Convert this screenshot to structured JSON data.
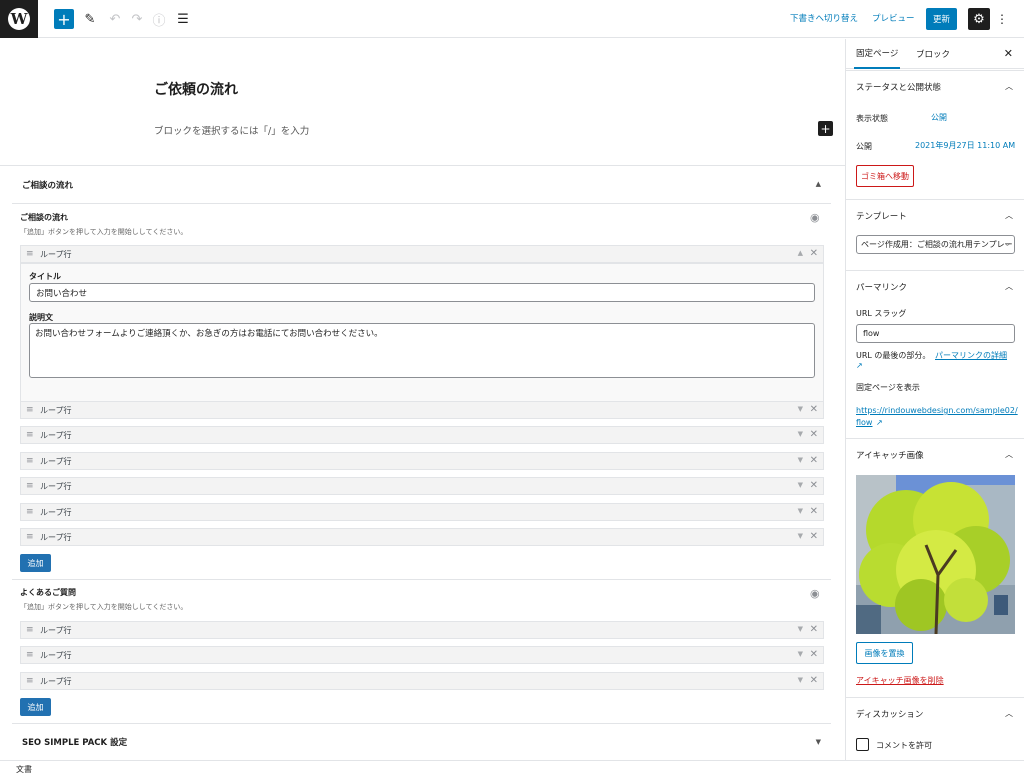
{
  "toolbar": {
    "logo": "W",
    "add_icon": "+",
    "save_draft": "下書きへ切り替え",
    "preview": "プレビュー",
    "update": "更新",
    "settings_icon": "⚙",
    "more_icon": "⋮"
  },
  "editor": {
    "title": "ご依頼の流れ",
    "placeholder": "ブロックを選択するには「/」を入力",
    "inline_add": "+"
  },
  "metabox": {
    "header": "ご相談の流れ",
    "section1": {
      "label": "ご相談の流れ",
      "desc": "「追加」ボタンを押して入力を開始ししてください。",
      "expanded_row": {
        "label": "ループ行",
        "title_label": "タイトル",
        "title_value": "お問い合わせ",
        "desc_label": "説明文",
        "desc_value": "お問い合わせフォームよりご連絡頂くか、お急ぎの方はお電話にてお問い合わせください。"
      },
      "rows": [
        "ループ行",
        "ループ行",
        "ループ行",
        "ループ行",
        "ループ行",
        "ループ行"
      ],
      "add_label": "追加"
    },
    "section2": {
      "label": "よくあるご質問",
      "desc": "「追加」ボタンを押して入力を開始ししてください。",
      "rows": [
        "ループ行",
        "ループ行",
        "ループ行"
      ],
      "add_label": "追加"
    },
    "seo_header": "SEO SIMPLE PACK 設定"
  },
  "footer": {
    "breadcrumb": "文書"
  },
  "sidebar": {
    "tab_page": "固定ページ",
    "tab_block": "ブロック",
    "close_icon": "✕",
    "status": {
      "title": "ステータスと公開状態",
      "visibility_label": "表示状態",
      "visibility_value": "公開",
      "publish_label": "公開",
      "publish_value": "2021年9月27日 11:10 AM",
      "trash": "ゴミ箱へ移動"
    },
    "template": {
      "title": "テンプレート",
      "value": "ページ作成用：ご相談の流れ用テンプレート"
    },
    "permalink": {
      "title": "パーマリンク",
      "slug_label": "URL スラッグ",
      "slug_value": "flow",
      "note": "URL の最後の部分。",
      "note_link": "パーマリンクの詳細",
      "view_label": "固定ページを表示",
      "url_line1": "https://rindouwebdesign.com/sample02/",
      "url_line2": "flow"
    },
    "featured": {
      "title": "アイキャッチ画像",
      "replace": "画像を置換",
      "remove": "アイキャッチ画像を削除"
    },
    "discussion": {
      "title": "ディスカッション",
      "allow_comments": "コメントを許可"
    }
  }
}
